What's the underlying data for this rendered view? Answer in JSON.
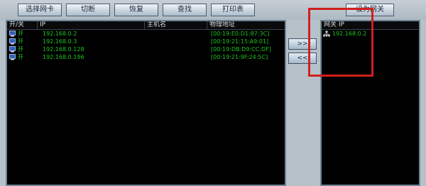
{
  "toolbar": {
    "buttons": [
      "选择网卡",
      "切断",
      "恢复",
      "查找",
      "打印表"
    ],
    "right_button": "设为网关"
  },
  "hosts_table": {
    "columns": {
      "on_off": "开/关",
      "ip": "IP",
      "hostname": "主机名",
      "mac": "物理地址"
    },
    "rows": [
      {
        "state": "开",
        "ip": "192.168.0.2",
        "hostname": "",
        "mac": "[00:19:E0:D1:87:3C]"
      },
      {
        "state": "开",
        "ip": "192.168.0.3",
        "hostname": "",
        "mac": "[00:19:21:15:A9:01]"
      },
      {
        "state": "开",
        "ip": "192.168.0.128",
        "hostname": "",
        "mac": "[00:19:DB:D9:CC:DF]"
      },
      {
        "state": "开",
        "ip": "192.168.0.196",
        "hostname": "",
        "mac": "[00:19:21:9F:24:5C]"
      }
    ]
  },
  "move_buttons": {
    "add": ">>",
    "remove": "<<"
  },
  "gateway_pane": {
    "header": "网关 IP",
    "items": [
      "192.168.0.2"
    ]
  },
  "colors": {
    "text_green": "#1ec421",
    "pane_bg": "#000000",
    "window_bg": "#b7c1c9",
    "highlight_border": "#d0201d"
  },
  "icons": {
    "host_row": "computer-monitor-icon",
    "gateway_item": "network-icon"
  }
}
